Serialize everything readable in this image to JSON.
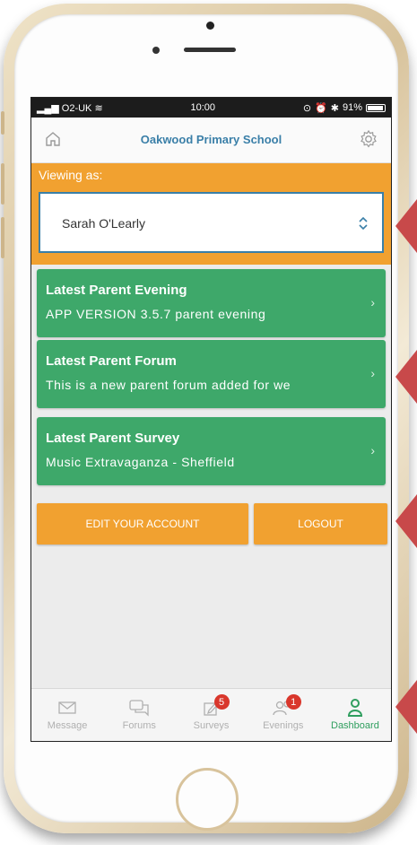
{
  "status_bar": {
    "carrier": "O2-UK",
    "time": "10:00",
    "battery": "91%"
  },
  "header": {
    "title": "Oakwood Primary School"
  },
  "viewing": {
    "label": "Viewing as:",
    "selected": "Sarah O'Learly"
  },
  "cards": [
    {
      "title": "Latest Parent Evening",
      "subtitle": "APP VERSION 3.5.7 parent evening"
    },
    {
      "title": "Latest Parent Forum",
      "subtitle": "This is a new parent forum added for we"
    },
    {
      "title": "Latest Parent Survey",
      "subtitle": "Music Extravaganza - Sheffield"
    }
  ],
  "buttons": {
    "edit": "EDIT YOUR ACCOUNT",
    "logout": "LOGOUT"
  },
  "tabs": [
    {
      "label": "Message",
      "icon": "envelope-icon"
    },
    {
      "label": "Forums",
      "icon": "chat-bubbles-icon"
    },
    {
      "label": "Surveys",
      "icon": "edit-survey-icon",
      "badge": "5"
    },
    {
      "label": "Evenings",
      "icon": "people-icon",
      "badge": "1"
    },
    {
      "label": "Dashboard",
      "icon": "person-icon",
      "active": true
    }
  ],
  "colors": {
    "accent_orange": "#f1a130",
    "card_green": "#3ea86a",
    "title_blue": "#3a7fa8",
    "badge_red": "#d9372c",
    "pointer_red": "#c8494a"
  }
}
